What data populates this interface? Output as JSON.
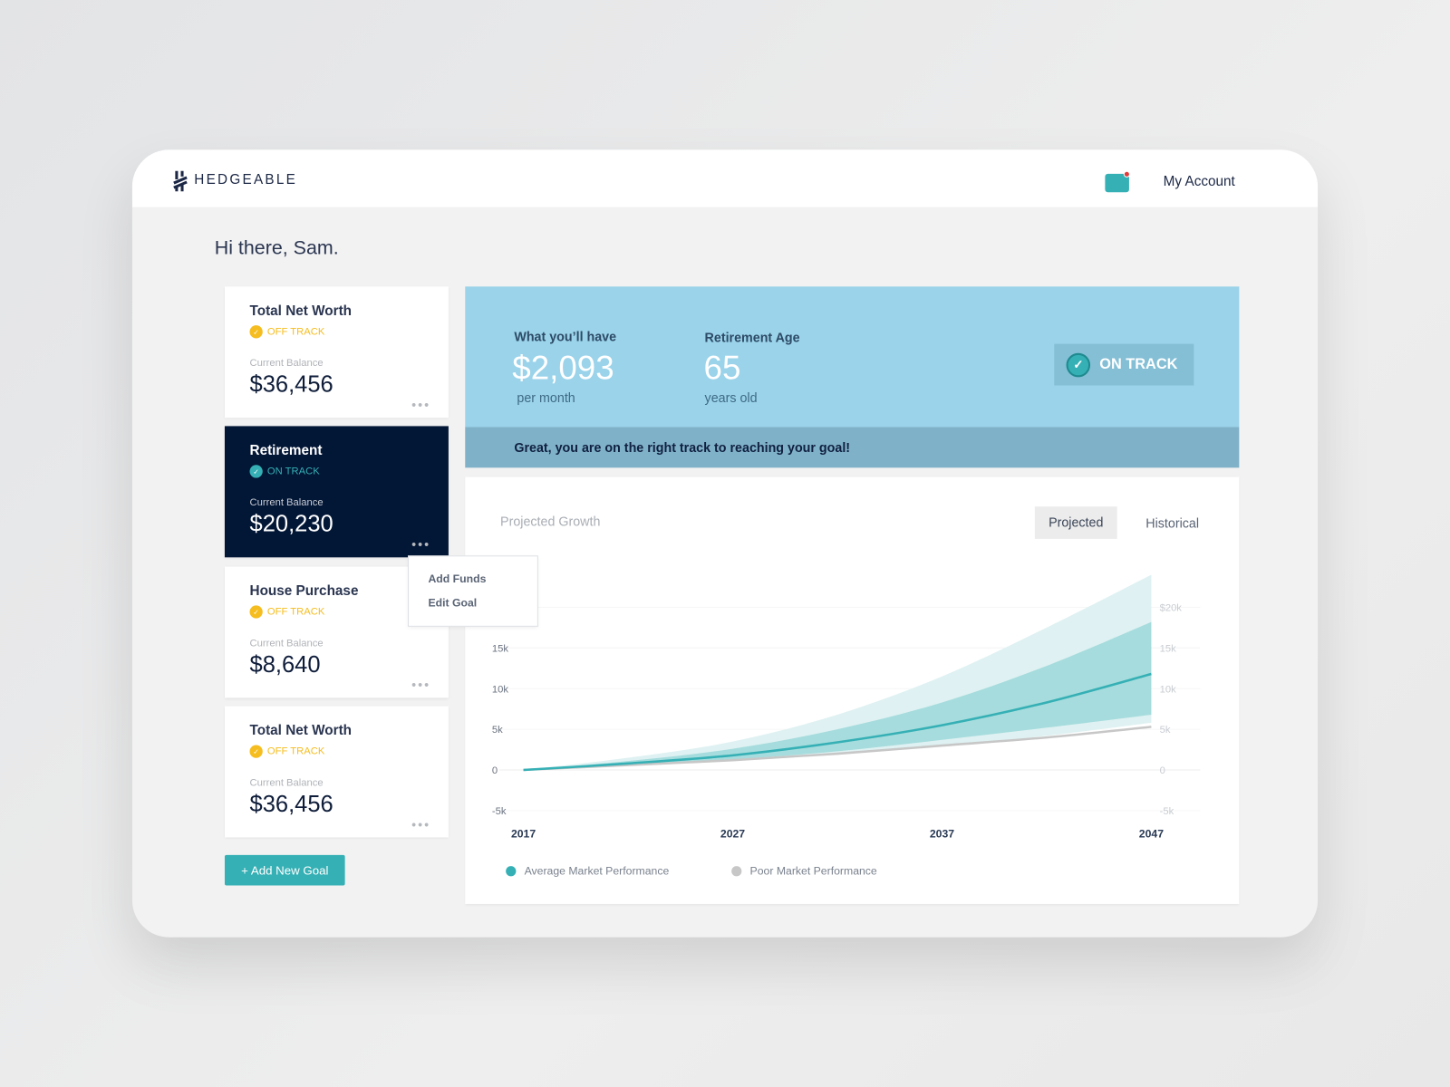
{
  "header": {
    "brand": "HEDGEABLE",
    "account": "My Account"
  },
  "greeting": "Hi there, Sam.",
  "goals": [
    {
      "title": "Total Net Worth",
      "status": "OFF TRACK",
      "balance_label": "Current Balance",
      "balance": "$36,456"
    },
    {
      "title": "Retirement",
      "status": "ON TRACK",
      "balance_label": "Current Balance",
      "balance": "$20,230"
    },
    {
      "title": "House Purchase",
      "status": "OFF TRACK",
      "balance_label": "Current Balance",
      "balance": "$8,640"
    },
    {
      "title": "Total Net Worth",
      "status": "OFF TRACK",
      "balance_label": "Current Balance",
      "balance": "$36,456"
    }
  ],
  "more": "•••",
  "add_goal": "+ Add New Goal",
  "menu": {
    "add_funds": "Add Funds",
    "edit_goal": "Edit Goal"
  },
  "summary": {
    "have_label": "What you’ll have",
    "have_value": "$2,093",
    "have_unit": "per month",
    "age_label": "Retirement Age",
    "age_value": "65",
    "age_unit": "years old",
    "status": "ON TRACK",
    "message": "Great, you are on the right track to reaching your goal!"
  },
  "colors": {
    "teal": "#35b0b5",
    "navy": "#021636",
    "off_track": "#f5bd1f",
    "sky": "#9ad3ea",
    "poor": "#c7c7c7"
  },
  "chart_data": {
    "type": "area",
    "title": "Projected Growth",
    "tabs": [
      "Projected",
      "Historical"
    ],
    "active_tab": "Projected",
    "x": [
      2017,
      2022,
      2027,
      2032,
      2037,
      2042,
      2047
    ],
    "x_ticks": [
      "2017",
      "2027",
      "2037",
      "2047"
    ],
    "y_ticks_left": [
      "-5k",
      "0",
      "5k",
      "10k",
      "15k"
    ],
    "y_ticks_right": [
      "-5k",
      "0",
      "5k",
      "10k",
      "15k",
      "$20k"
    ],
    "ylim": [
      -5000,
      24000
    ],
    "grid": true,
    "series": [
      {
        "name": "Average Market Performance",
        "values": [
          0,
          800,
          1800,
          3400,
          5500,
          8300,
          11800
        ]
      },
      {
        "name": "Poor Market Performance",
        "values": [
          0,
          600,
          1200,
          2000,
          3000,
          4000,
          5300
        ]
      }
    ],
    "bands": [
      {
        "upper": [
          0,
          1500,
          3500,
          6800,
          11500,
          17500,
          24000
        ],
        "lower": [
          0,
          500,
          1100,
          1900,
          2900,
          4200,
          5800
        ]
      },
      {
        "upper": [
          0,
          1100,
          2600,
          5000,
          8300,
          12800,
          18200
        ],
        "lower": [
          0,
          600,
          1300,
          2300,
          3700,
          5200,
          6800
        ]
      }
    ],
    "legend_position": "bottom-left"
  }
}
